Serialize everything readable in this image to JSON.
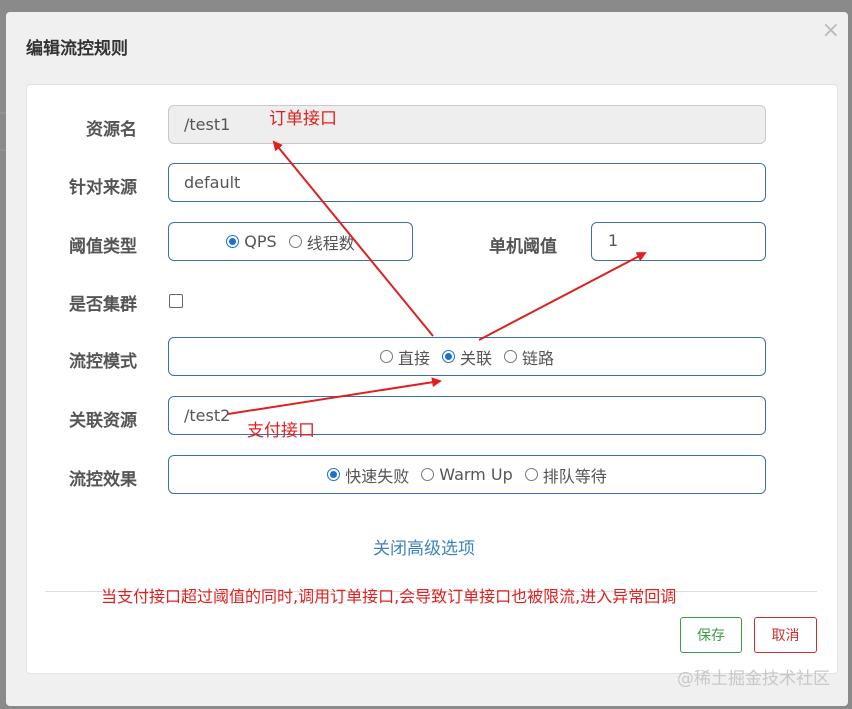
{
  "dialog": {
    "title": "编辑流控规则",
    "close_label": "×"
  },
  "form": {
    "resource_name": {
      "label": "资源名",
      "value": "/test1"
    },
    "limit_app": {
      "label": "针对来源",
      "value": "default"
    },
    "threshold_type": {
      "label": "阈值类型",
      "options": [
        {
          "label": "QPS",
          "checked": true
        },
        {
          "label": "线程数",
          "checked": false
        }
      ]
    },
    "threshold": {
      "label": "单机阈值",
      "value": "1"
    },
    "cluster_mode": {
      "label": "是否集群",
      "checked": false
    },
    "strategy": {
      "label": "流控模式",
      "options": [
        {
          "label": "直接",
          "checked": false
        },
        {
          "label": "关联",
          "checked": true
        },
        {
          "label": "链路",
          "checked": false
        }
      ]
    },
    "ref_resource": {
      "label": "关联资源",
      "value": "/test2"
    },
    "control_behavior": {
      "label": "流控效果",
      "options": [
        {
          "label": "快速失败",
          "checked": true
        },
        {
          "label": "Warm Up",
          "checked": false
        },
        {
          "label": "排队等待",
          "checked": false
        }
      ]
    },
    "advanced_toggle": "关闭高级选项"
  },
  "footer": {
    "save_label": "保存",
    "cancel_label": "取消"
  },
  "annotations": {
    "order_api": "订单接口",
    "pay_api": "支付接口",
    "explanation": "当支付接口超过阈值的同时,调用订单接口,会导致订单接口也被限流,进入异常回调",
    "color": "#e02020"
  },
  "watermark": "@稀土掘金技术社区",
  "colors": {
    "input_border": "#3a6fae",
    "link": "#3d82c0",
    "radio_checked": "#1f6fd1",
    "save": "#3c9d46",
    "cancel": "#c9302c"
  }
}
